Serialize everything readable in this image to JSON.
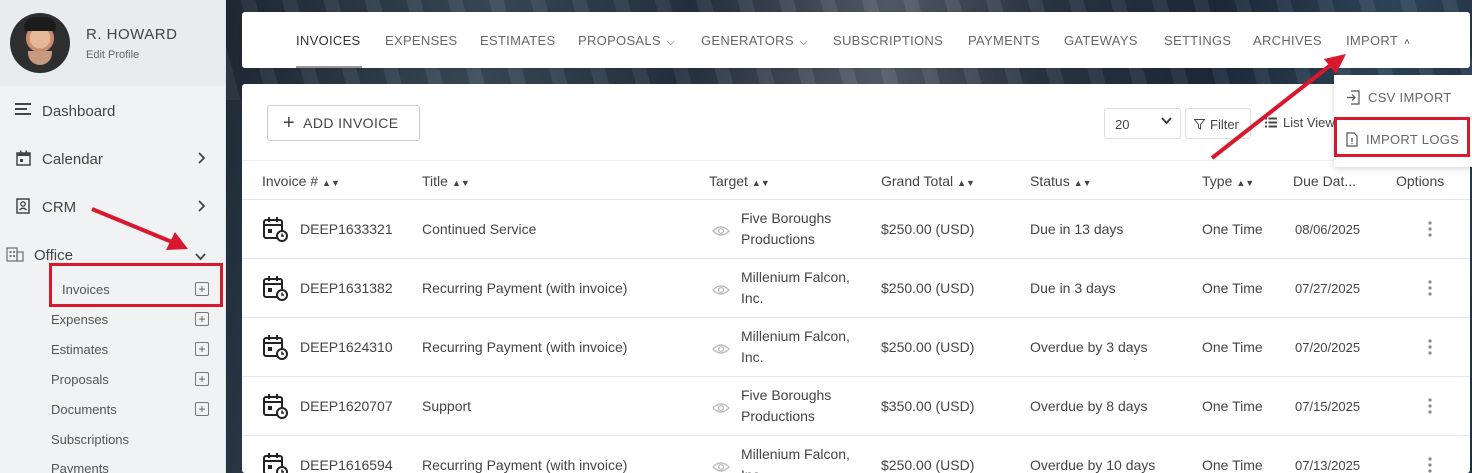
{
  "profile": {
    "name": "R. HOWARD",
    "edit_label": "Edit Profile"
  },
  "sidebar": {
    "items": [
      {
        "label": "Dashboard",
        "icon": "menu-icon"
      },
      {
        "label": "Calendar",
        "icon": "calendar-icon"
      },
      {
        "label": "CRM",
        "icon": "contact-icon"
      },
      {
        "label": "Office",
        "icon": "office-icon"
      }
    ],
    "office_subitems": [
      {
        "label": "Invoices"
      },
      {
        "label": "Expenses"
      },
      {
        "label": "Estimates"
      },
      {
        "label": "Proposals"
      },
      {
        "label": "Documents"
      },
      {
        "label": "Subscriptions"
      },
      {
        "label": "Payments"
      }
    ]
  },
  "topnav": {
    "tabs": [
      {
        "label": "INVOICES"
      },
      {
        "label": "EXPENSES"
      },
      {
        "label": "ESTIMATES"
      },
      {
        "label": "PROPOSALS"
      },
      {
        "label": "GENERATORS"
      },
      {
        "label": "SUBSCRIPTIONS"
      },
      {
        "label": "PAYMENTS"
      },
      {
        "label": "GATEWAYS"
      },
      {
        "label": "SETTINGS"
      },
      {
        "label": "ARCHIVES"
      },
      {
        "label": "IMPORT"
      }
    ]
  },
  "import_menu": {
    "csv_import": "CSV IMPORT",
    "import_logs": "IMPORT LOGS"
  },
  "toolbar": {
    "add_invoice": "ADD INVOICE",
    "per_page": "20",
    "filter": "Filter",
    "list_view": "List View"
  },
  "table": {
    "headers": [
      "Invoice #",
      "Title",
      "Target",
      "Grand Total",
      "Status",
      "Type",
      "Due Dat...",
      "Options"
    ],
    "rows": [
      {
        "invoice": "DEEP1633321",
        "title": "Continued Service",
        "target": "Five Boroughs Productions",
        "total": "$250.00 (USD)",
        "status": "Due in 13 days",
        "type": "One Time",
        "due": "08/06/2025"
      },
      {
        "invoice": "DEEP1631382",
        "title": "Recurring Payment (with invoice)",
        "target": "Millenium Falcon, Inc.",
        "total": "$250.00 (USD)",
        "status": "Due in 3 days",
        "type": "One Time",
        "due": "07/27/2025"
      },
      {
        "invoice": "DEEP1624310",
        "title": "Recurring Payment (with invoice)",
        "target": "Millenium Falcon, Inc.",
        "total": "$250.00 (USD)",
        "status": "Overdue by 3 days",
        "type": "One Time",
        "due": "07/20/2025"
      },
      {
        "invoice": "DEEP1620707",
        "title": "Support",
        "target": "Five Boroughs Productions",
        "total": "$350.00 (USD)",
        "status": "Overdue by 8 days",
        "type": "One Time",
        "due": "07/15/2025"
      },
      {
        "invoice": "DEEP1616594",
        "title": "Recurring Payment (with invoice)",
        "target": "Millenium Falcon, Inc.",
        "total": "$250.00 (USD)",
        "status": "Overdue by 10 days",
        "type": "One Time",
        "due": "07/13/2025"
      }
    ]
  },
  "colors": {
    "highlight": "#d9182d",
    "text": "#444444",
    "sidebar_bg": "#f1f2f3"
  }
}
